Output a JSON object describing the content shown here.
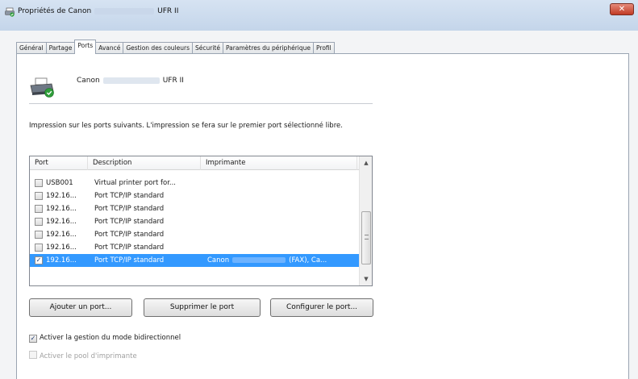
{
  "window": {
    "title_prefix": "Propriétés de Canon",
    "title_suffix": "UFR II",
    "close_glyph": "✕"
  },
  "tabs": [
    {
      "label": "Général",
      "active": false
    },
    {
      "label": "Partage",
      "active": false
    },
    {
      "label": "Ports",
      "active": true
    },
    {
      "label": "Avancé",
      "active": false
    },
    {
      "label": "Gestion des couleurs",
      "active": false
    },
    {
      "label": "Sécurité",
      "active": false
    },
    {
      "label": "Paramètres du périphérique",
      "active": false
    },
    {
      "label": "Profil",
      "active": false
    }
  ],
  "printer": {
    "name_prefix": "Canon",
    "name_suffix": "UFR II"
  },
  "intro_text": "Impression sur les ports suivants. L'impression se fera sur le premier port sélectionné libre.",
  "ports_list": {
    "columns": {
      "port": "Port",
      "description": "Description",
      "printer": "Imprimante"
    },
    "rows": [
      {
        "port": "USB001",
        "description": "Virtual printer port for...",
        "printer": "",
        "checked": false,
        "selected": false
      },
      {
        "port": "192.16...",
        "description": "Port TCP/IP standard",
        "printer": "",
        "checked": false,
        "selected": false
      },
      {
        "port": "192.16...",
        "description": "Port TCP/IP standard",
        "printer": "",
        "checked": false,
        "selected": false
      },
      {
        "port": "192.16...",
        "description": "Port TCP/IP standard",
        "printer": "",
        "checked": false,
        "selected": false
      },
      {
        "port": "192.16...",
        "description": "Port TCP/IP standard",
        "printer": "",
        "checked": false,
        "selected": false
      },
      {
        "port": "192.16...",
        "description": "Port TCP/IP standard",
        "printer": "",
        "checked": false,
        "selected": false
      },
      {
        "port": "192.16...",
        "description": "Port TCP/IP standard",
        "printer_prefix": "Canon",
        "printer_suffix": "(FAX), Ca...",
        "checked": true,
        "selected": true
      }
    ],
    "scroll_up_glyph": "▲",
    "scroll_down_glyph": "▼"
  },
  "buttons": {
    "add": "Ajouter un port...",
    "delete": "Supprimer le port",
    "configure": "Configurer le port..."
  },
  "options": {
    "bidirectional": {
      "label": "Activer la gestion du mode bidirectionnel",
      "checked": true,
      "enabled": true
    },
    "pooling": {
      "label": "Activer le pool d'imprimante",
      "checked": false,
      "enabled": false
    }
  },
  "check_glyph": "✓",
  "colors": {
    "selection": "#3399ff",
    "title_bar": "#c4d5ea",
    "close_button": "#c13a24"
  }
}
